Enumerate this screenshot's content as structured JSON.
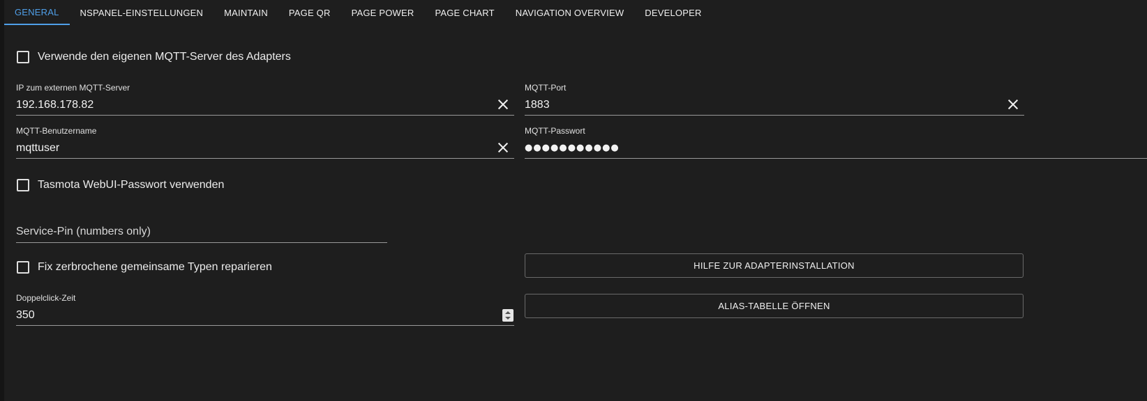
{
  "tabs": [
    {
      "label": "GENERAL",
      "active": true
    },
    {
      "label": "NSPANEL-EINSTELLUNGEN",
      "active": false
    },
    {
      "label": "MAINTAIN",
      "active": false
    },
    {
      "label": "PAGE QR",
      "active": false
    },
    {
      "label": "PAGE POWER",
      "active": false
    },
    {
      "label": "PAGE CHART",
      "active": false
    },
    {
      "label": "NAVIGATION OVERVIEW",
      "active": false
    },
    {
      "label": "DEVELOPER",
      "active": false
    }
  ],
  "accent_color": "#4f9fe8",
  "checkboxes": {
    "own_mqtt": {
      "label": "Verwende den eigenen MQTT-Server des Adapters",
      "checked": false
    },
    "tasmota_pw": {
      "label": "Tasmota WebUI-Passwort verwenden",
      "checked": false
    },
    "fix_types": {
      "label": "Fix zerbrochene gemeinsame Typen reparieren",
      "checked": false
    }
  },
  "fields": {
    "mqtt_ip": {
      "label": "IP zum externen MQTT-Server",
      "value": "192.168.178.82"
    },
    "mqtt_port": {
      "label": "MQTT-Port",
      "value": "1883"
    },
    "mqtt_user": {
      "label": "MQTT-Benutzername",
      "value": "mqttuser"
    },
    "mqtt_password": {
      "label": "MQTT-Passwort",
      "value": "●●●●●●●●●●●"
    },
    "service_pin": {
      "placeholder": "Service-Pin (numbers only)"
    },
    "doubleclick": {
      "label": "Doppelclick-Zeit",
      "value": "350"
    }
  },
  "buttons": {
    "help": "HILFE ZUR ADAPTERINSTALLATION",
    "alias": "ALIAS-TABELLE ÖFFNEN"
  },
  "icons": {
    "clear": "close-icon",
    "stepper": "number-stepper-icon"
  }
}
